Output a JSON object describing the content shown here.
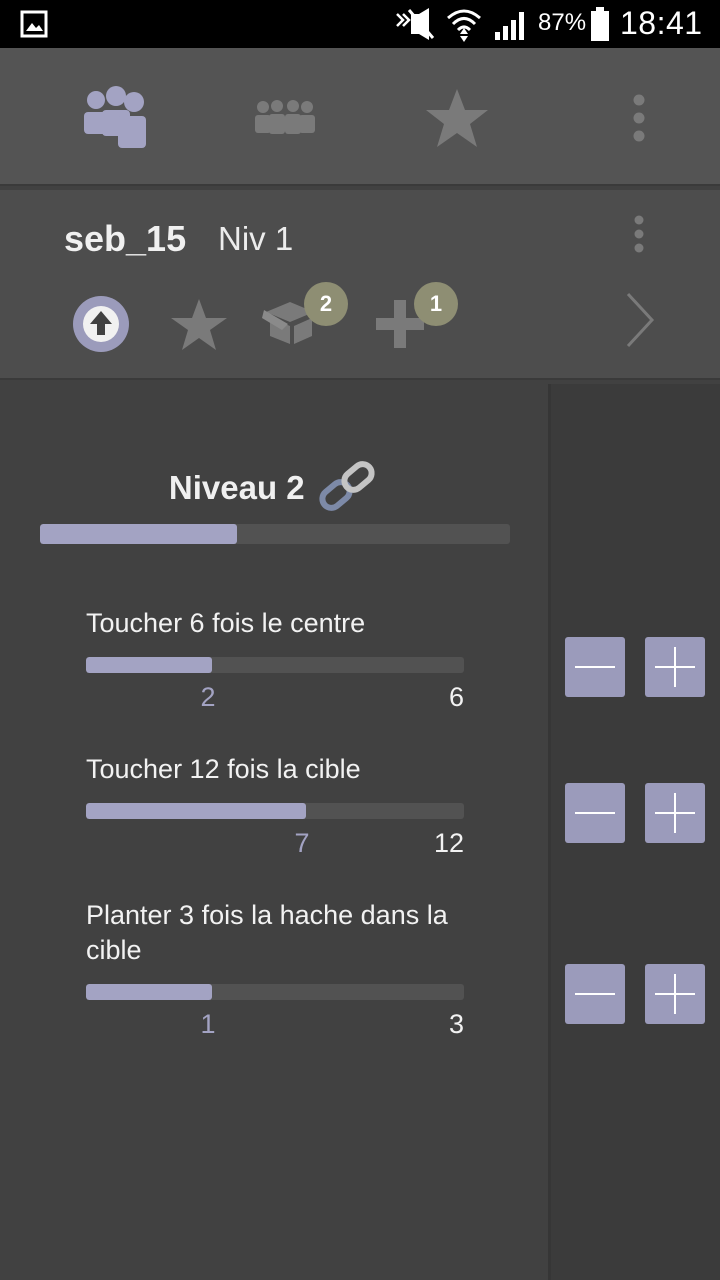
{
  "status_bar": {
    "battery_percent": "87%",
    "time": "18:41",
    "icons": [
      "gallery-icon",
      "mute-icon",
      "wifi-icon",
      "signal-icon",
      "battery-icon"
    ]
  },
  "tabs": [
    {
      "name": "players",
      "icon": "group-icon",
      "selected": true
    },
    {
      "name": "teams",
      "icon": "team-icon",
      "selected": false
    },
    {
      "name": "favorites",
      "icon": "star-icon",
      "selected": false
    }
  ],
  "profile": {
    "username": "seb_15",
    "level_label": "Niv 1",
    "actions": [
      {
        "icon": "upload-circle-icon"
      },
      {
        "icon": "star-icon"
      },
      {
        "icon": "box-icon",
        "badge": "2"
      },
      {
        "icon": "plus-icon",
        "badge": "1"
      }
    ]
  },
  "level": {
    "title": "Niveau 2",
    "progress": 0.42
  },
  "objectives": [
    {
      "label": "Toucher 6 fois le centre",
      "current": "2",
      "max": "6",
      "progress": 0.333
    },
    {
      "label": "Toucher 12 fois la cible",
      "current": "7",
      "max": "12",
      "progress": 0.583
    },
    {
      "label": "Planter 3 fois la hache dans la cible",
      "current": "1",
      "max": "3",
      "progress": 0.333
    }
  ],
  "colors": {
    "accent": "#a3a3c3",
    "badge": "#8e8e73",
    "button": "#9b9bbb"
  }
}
